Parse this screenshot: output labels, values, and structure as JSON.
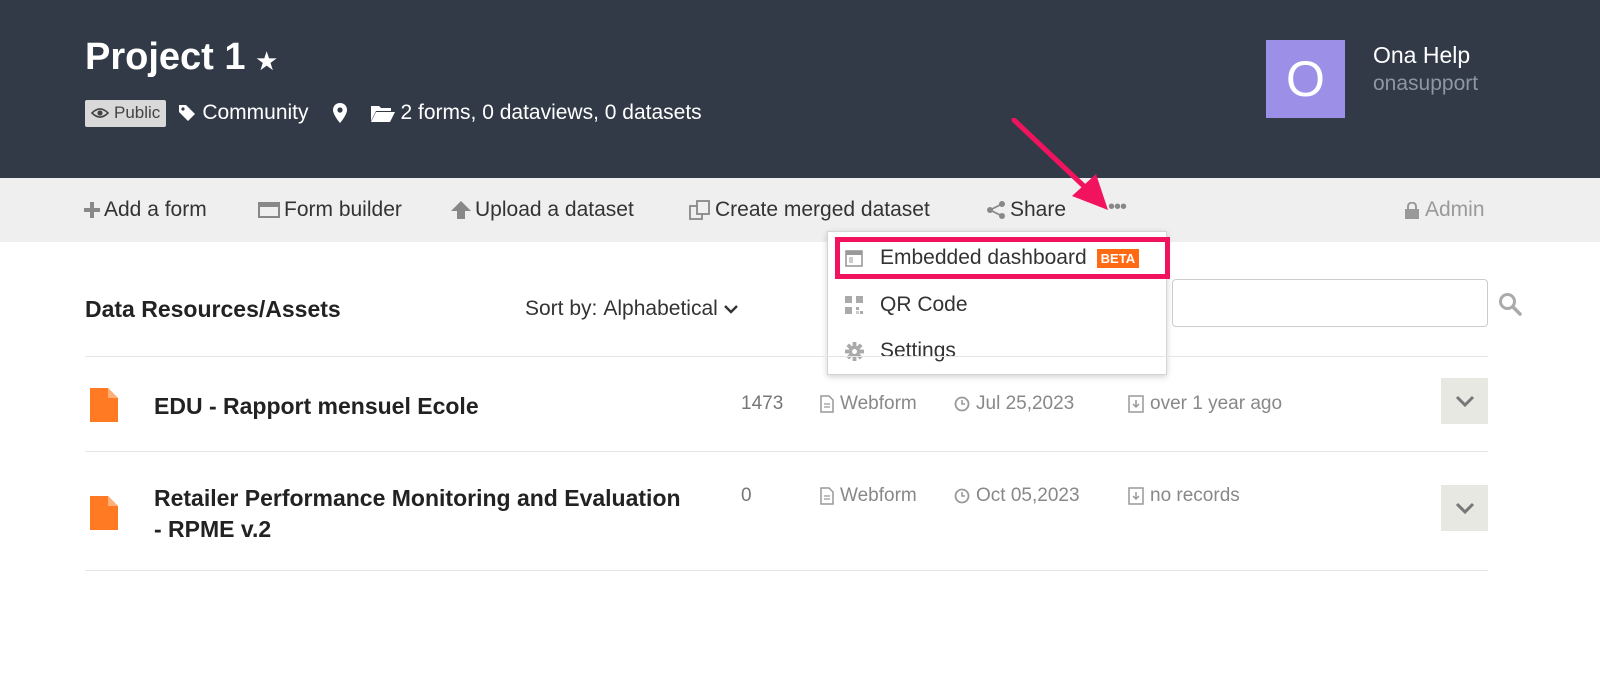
{
  "header": {
    "project_title": "Project 1",
    "badge_public": "Public",
    "tag": "Community",
    "summary": "2 forms, 0 dataviews, 0 datasets",
    "user": {
      "avatar_letter": "O",
      "name": "Ona Help",
      "handle": "onasupport"
    }
  },
  "toolbar": {
    "add_form": "Add a form",
    "form_builder": "Form builder",
    "upload_dataset": "Upload a dataset",
    "create_merged": "Create merged dataset",
    "share": "Share",
    "more": "•••",
    "admin": "Admin"
  },
  "dropdown": {
    "items": [
      {
        "label": "Embedded dashboard",
        "badge": "BETA",
        "icon": "dashboard-icon"
      },
      {
        "label": "QR Code",
        "icon": "qr-code-icon"
      },
      {
        "label": "Settings",
        "icon": "gear-icon"
      }
    ]
  },
  "content": {
    "section_title": "Data Resources/Assets",
    "sort_label": "Sort by:",
    "sort_value": "Alphabetical",
    "search_placeholder": ""
  },
  "forms": [
    {
      "title_line1": "EDU - Rapport mensuel Ecole",
      "title_line2": "",
      "count": "1473",
      "type": "Webform",
      "date": "Jul 25,2023",
      "updated": "over 1 year ago"
    },
    {
      "title_line1": "Retailer Performance Monitoring and Evaluation",
      "title_line2": "- RPME v.2",
      "count": "0",
      "type": "Webform",
      "date": "Oct 05,2023",
      "updated": "no records"
    }
  ],
  "colors": {
    "header_bg": "#323a47",
    "highlight": "#f1135e",
    "beta": "#ff6a13",
    "file_icon": "#ff7a22",
    "avatar": "#9b8fe8"
  }
}
